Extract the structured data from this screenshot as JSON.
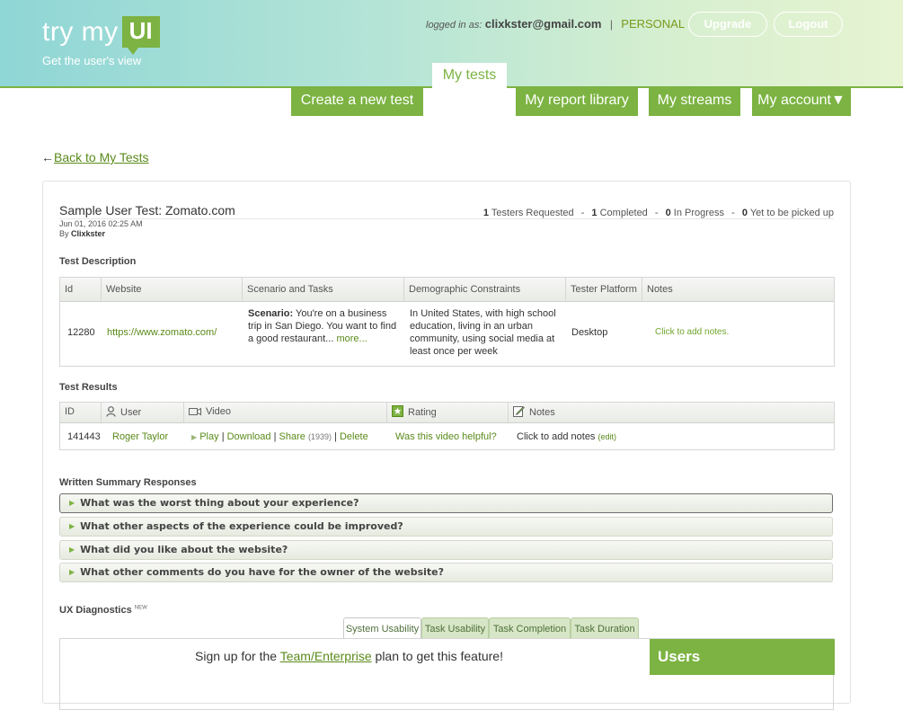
{
  "header": {
    "logo_text": "try my",
    "logo_ui": "UI",
    "tagline": "Get the user's view",
    "login_label": "logged in as:",
    "login_email": "clixkster@gmail.com",
    "separator": "|",
    "plan": "PERSONAL",
    "upgrade_label": "Upgrade",
    "logout_label": "Logout"
  },
  "nav": {
    "active_tab": "My tests",
    "create_label": "Create a new test",
    "report_library_label": "My report library",
    "streams_label": "My streams",
    "account_label": "My account▼"
  },
  "back_link": {
    "arrow": "←",
    "label": "Back to My Tests"
  },
  "test": {
    "title": "Sample User Test: Zomato.com",
    "date": "Jun 01, 2016 02:25 AM",
    "by_label": "By",
    "by_user": "Clixkster",
    "stats": {
      "requested_count": "1",
      "requested_label": "Testers Requested",
      "completed_count": "1",
      "completed_label": "Completed",
      "in_progress_count": "0",
      "in_progress_label": "In Progress",
      "yet_count": "0",
      "yet_label": "Yet to be picked up",
      "dash": "-"
    }
  },
  "description": {
    "heading": "Test Description",
    "columns": [
      "Id",
      "Website",
      "Scenario and Tasks",
      "Demographic Constraints",
      "Tester Platform",
      "Notes"
    ],
    "row": {
      "id": "12280",
      "website": "https://www.zomato.com/",
      "scenario_label": "Scenario:",
      "scenario_text": "You're on a business trip in San Diego. You want to find a good restaurant...",
      "more": "more...",
      "demographic": "In United States, with high school education, living in an urban community, using social media at least once per week",
      "platform": "Desktop",
      "notes": "Click to add notes."
    }
  },
  "results": {
    "heading": "Test Results",
    "columns": {
      "id": "ID",
      "user": "User",
      "video": "Video",
      "rating": "Rating",
      "notes": "Notes"
    },
    "row": {
      "id": "141443",
      "user": "Roger Taylor",
      "play_icon": "▶",
      "play": "Play",
      "bar": "|",
      "download": "Download",
      "share": "Share",
      "share_count": "(1939)",
      "delete": "Delete",
      "rating": "Was this video helpful?",
      "notes": "Click to add notes",
      "edit": "(edit)"
    }
  },
  "summary": {
    "heading": "Written Summary Responses",
    "items": [
      "What was the worst thing about your experience?",
      "What other aspects of the experience could be improved?",
      "What did you like about the website?",
      "What other comments do you have for the owner of the website?"
    ]
  },
  "ux": {
    "heading": "UX Diagnostics",
    "new_badge": "NEW",
    "tabs": [
      "System Usability",
      "Task Usability",
      "Task Completion",
      "Task Duration"
    ],
    "signup_prefix": "Sign up for the",
    "signup_link": "Team/Enterprise",
    "signup_suffix": "plan to get this feature!",
    "users_panel": "Users"
  },
  "colors": {
    "brand_green": "#7cb342",
    "link_green": "#5a8a1a",
    "header_teal": "#8fd6d6"
  }
}
